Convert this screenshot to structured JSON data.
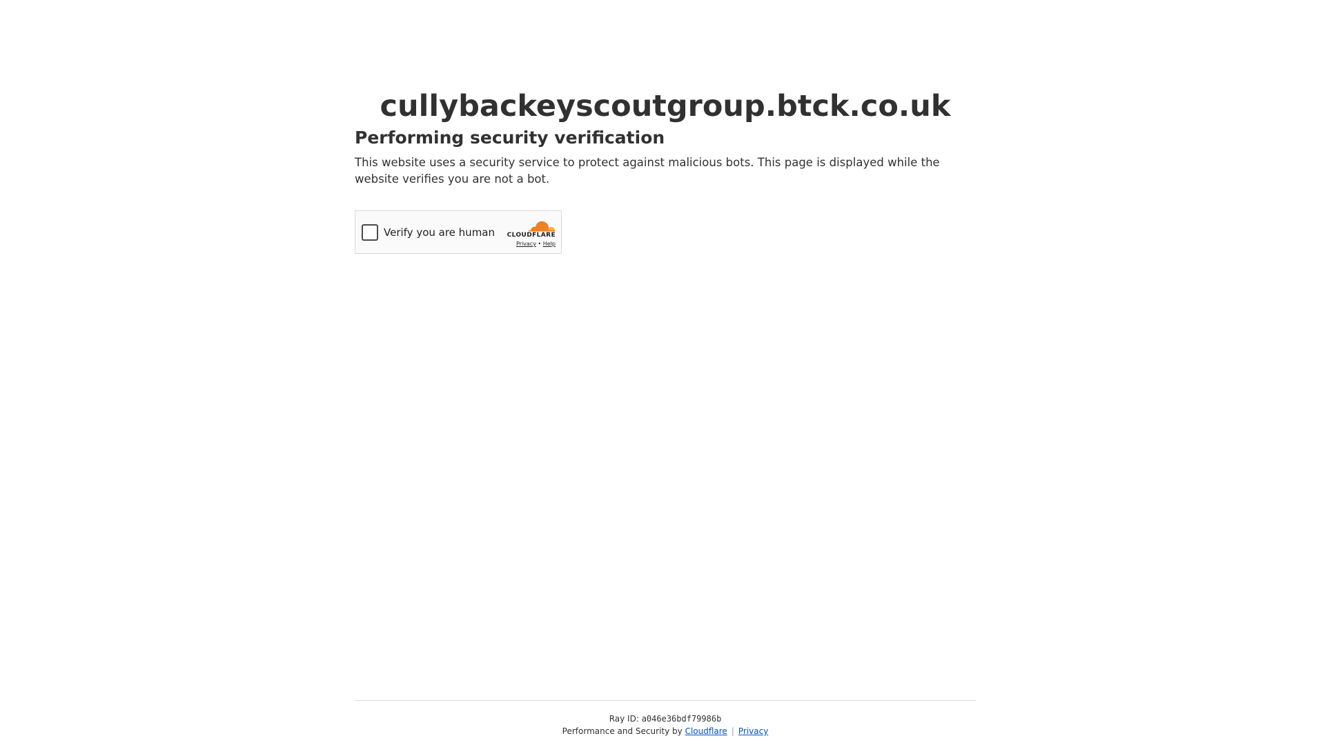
{
  "site": {
    "domain": "cullybackeyscoutgroup.btck.co.uk"
  },
  "main": {
    "heading": "Performing security verification",
    "description": "This website uses a security service to protect against malicious bots. This page is displayed while the website verifies you are not a bot."
  },
  "widget": {
    "checkbox_label": "Verify you are human",
    "checked": false,
    "brand_name": "CLOUDFLARE",
    "privacy_link": "Privacy",
    "links_separator": "•",
    "help_link": "Help",
    "brand_icon": "cloudflare-cloud-icon",
    "brand_color_primary": "#f38020",
    "brand_color_secondary": "#faae40"
  },
  "footer": {
    "ray_label": "Ray ID:",
    "ray_id": "a046e36bdf79986b",
    "performance_text": "Performance and Security by",
    "cloudflare_link": "Cloudflare",
    "separator": "|",
    "privacy_link": "Privacy",
    "link_color": "#0051c3"
  }
}
